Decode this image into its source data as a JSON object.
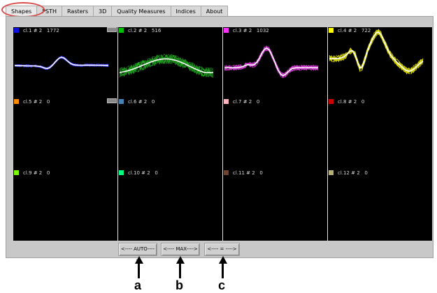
{
  "tabs": [
    {
      "label": "Shapes",
      "active": true
    },
    {
      "label": "PSTH"
    },
    {
      "label": "Rasters"
    },
    {
      "label": "3D"
    },
    {
      "label": "Quality Measures"
    },
    {
      "label": "Indices"
    },
    {
      "label": "About"
    }
  ],
  "clusters": [
    {
      "label": "cl.1 # 2   1772",
      "color": "#1010e0",
      "wave": "#3b3bff",
      "has_waveform": true,
      "scale_box": true
    },
    {
      "label": "cl.2 # 2   516",
      "color": "#00c000",
      "wave": "#22b022",
      "has_waveform": true
    },
    {
      "label": "cl.3 # 2   1032",
      "color": "#ff33ff",
      "wave": "#e040e0",
      "has_waveform": true
    },
    {
      "label": "cl.4 # 2   722",
      "color": "#ffff00",
      "wave": "#e8e800",
      "has_waveform": true
    },
    {
      "label": "cl.5 # 2   0",
      "color": "#ff8c00",
      "scale_box": true
    },
    {
      "label": "cl.6 # 2   0",
      "color": "#4682b4"
    },
    {
      "label": "cl.7 # 2   0",
      "color": "#ffb6c1"
    },
    {
      "label": "cl.8 # 2   0",
      "color": "#cc0000"
    },
    {
      "label": "cl.9 # 2   0",
      "color": "#7cfc00"
    },
    {
      "label": "cl.10 # 2   0",
      "color": "#00ff7f"
    },
    {
      "label": "cl.11 # 2   0",
      "color": "#6b4432"
    },
    {
      "label": "cl.12 # 2   0",
      "color": "#b5b07a"
    }
  ],
  "buttons": {
    "auto": "<---- AUTO---->",
    "max": "<---- MAX---->",
    "equal": "<----  =  ---->"
  },
  "annotations": {
    "a": "a",
    "b": "b",
    "c": "c"
  }
}
